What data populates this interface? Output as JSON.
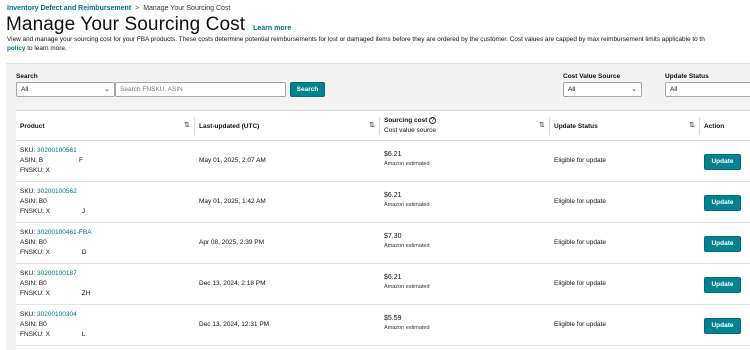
{
  "breadcrumb": {
    "parent": "Inventory Defect and Reimbursement",
    "separator": ">",
    "current": "Manage Your Sourcing Cost"
  },
  "header": {
    "title": "Manage Your Sourcing Cost",
    "learn_more": "Learn more"
  },
  "description": {
    "text": "View and manage your sourcing cost for your FBA products. These costs determine potential reimbursements for lost or damaged items before they are ordered by the customer. Cost values are capped by max reimbursement limits applicable to th",
    "policy_link": "policy",
    "suffix": " to learn more."
  },
  "filters": {
    "search_label": "Search",
    "search_scope_value": "All",
    "search_placeholder": "Search FNSKU, ASIN",
    "search_button": "Search",
    "cost_source_label": "Cost Value Source",
    "cost_source_value": "All",
    "update_status_label": "Update Status",
    "update_status_value": "All"
  },
  "table": {
    "columns": {
      "product": "Product",
      "last_updated": "Last-updated (UTC)",
      "sourcing_cost": "Sourcing cost",
      "cost_value_source": "Cost value source",
      "update_status": "Update Status",
      "action": "Action"
    },
    "rows": [
      {
        "sku_label": "SKU: ",
        "sku": "30200100561",
        "asin": "ASIN: B",
        "asin_tail": "F",
        "fnsku": "FNSKU: X",
        "fnsku_tail": "",
        "last_updated": "May 01, 2025, 2:07 AM",
        "cost": "$6.21",
        "source": "Amazon estimated",
        "status": "Eligible for update",
        "action": "Update"
      },
      {
        "sku_label": "SKU: ",
        "sku": "30200100562",
        "asin": "ASIN: B0",
        "asin_tail": "",
        "fnsku": "FNSKU: X",
        "fnsku_tail": "J",
        "last_updated": "May 01, 2025, 1:42 AM",
        "cost": "$6.21",
        "source": "Amazon estimated",
        "status": "Eligible for update",
        "action": "Update"
      },
      {
        "sku_label": "SKU: ",
        "sku": "30200100461-FBA",
        "asin": "ASIN: B0",
        "asin_tail": "",
        "fnsku": "FNSKU: X",
        "fnsku_tail": "D",
        "last_updated": "Apr 08, 2025, 2:39 PM",
        "cost": "$7.30",
        "source": "Amazon estimated",
        "status": "Eligible for update",
        "action": "Update"
      },
      {
        "sku_label": "SKU: ",
        "sku": "30200100187",
        "asin": "ASIN: B0",
        "asin_tail": "",
        "fnsku": "FNSKU: X",
        "fnsku_tail": "ZH",
        "last_updated": "Dec 13, 2024, 2:18 PM",
        "cost": "$6.21",
        "source": "Amazon estimated",
        "status": "Eligible for update",
        "action": "Update"
      },
      {
        "sku_label": "SKU: ",
        "sku": "30200100304",
        "asin": "ASIN: B0",
        "asin_tail": "",
        "fnsku": "FNSKU: X",
        "fnsku_tail": "L",
        "last_updated": "Dec 13, 2024, 12:31 PM",
        "cost": "$5.59",
        "source": "Amazon estimated",
        "status": "Eligible for update",
        "action": "Update"
      }
    ]
  },
  "icons": {
    "sort": "sort-icon",
    "info": "info-icon",
    "chevron": "chevron-down-icon"
  }
}
